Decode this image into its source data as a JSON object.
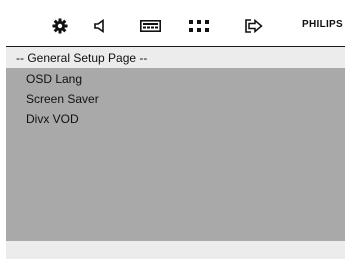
{
  "toolbar": {
    "icons": [
      "general-setup-gear",
      "audio-speaker",
      "video-screen",
      "preference-dots",
      "exit-arrow"
    ],
    "brand": "PHILIPS"
  },
  "header": {
    "title": "-- General Setup Page --"
  },
  "menu": {
    "items": [
      "OSD Lang",
      "Screen Saver",
      "Divx VOD"
    ]
  }
}
